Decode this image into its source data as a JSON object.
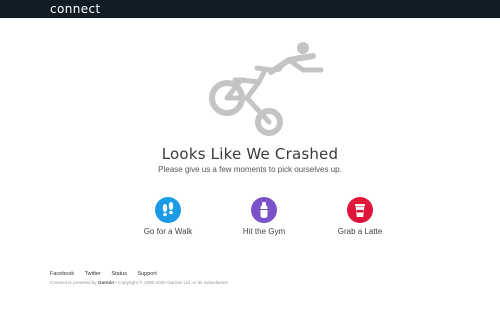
{
  "header": {
    "brand": "connect"
  },
  "error": {
    "title": "Looks Like We Crashed",
    "subtitle": "Please give us a few moments to pick ourselves up."
  },
  "options": [
    {
      "label": "Go for a Walk",
      "icon": "footprints-icon",
      "color": "#1a9be6"
    },
    {
      "label": "Hit the Gym",
      "icon": "water-bottle-icon",
      "color": "#7b52c8"
    },
    {
      "label": "Grab a Latte",
      "icon": "coffee-cup-icon",
      "color": "#e0153a"
    }
  ],
  "footer": {
    "links": [
      "Facebook",
      "Twitter",
      "Status",
      "Support"
    ],
    "powered_prefix": "Connect is powered by",
    "powered_brand": "Garmin",
    "copyright": "• Copyright © 1996-2020 Garmin Ltd. or its subsidiaries"
  },
  "colors": {
    "topbar": "#111c25",
    "illustration": "#c4c4c4"
  }
}
